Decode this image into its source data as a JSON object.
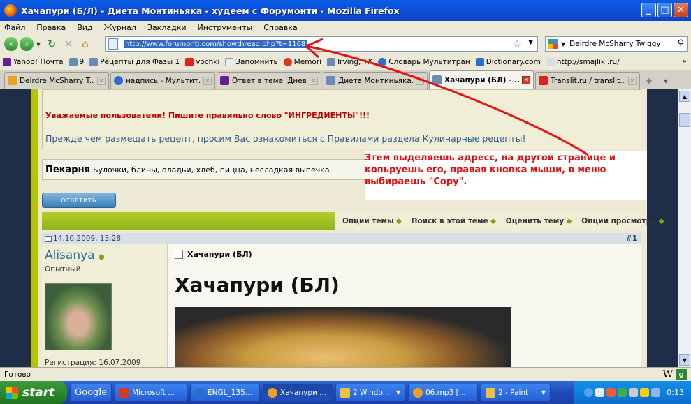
{
  "window": {
    "title": "Хачапури (Б/Л) - Диета Монтиньяка - худеем с Форумонти - Mozilla Firefox",
    "buttons": [
      "_",
      "□",
      "✕"
    ]
  },
  "menu": [
    "Файл",
    "Правка",
    "Вид",
    "Журнал",
    "Закладки",
    "Инструменты",
    "Справка"
  ],
  "nav": {
    "url": "http://www.forumonti.com/showthread.php?t=1168",
    "search_value": "Deirdre McSharry Twiggy"
  },
  "bookmarks": [
    {
      "label": "Yahoo! Почта",
      "color": "#6a1b9a"
    },
    {
      "label": "9",
      "color": "#6b8bb8"
    },
    {
      "label": "Рецепты для Фазы 1",
      "color": "#6b8bb8"
    },
    {
      "label": "vochki",
      "color": "#d9231c"
    },
    {
      "label": "Запомнить",
      "color": "#e6eefa"
    },
    {
      "label": "Memori",
      "color": "#d9391c"
    },
    {
      "label": "Irving, TX",
      "color": "#6b8bb8"
    },
    {
      "label": "Словарь Мультитран",
      "color": "#2a6fd0"
    },
    {
      "label": "Dictionary.com",
      "color": "#2a6fd0"
    },
    {
      "label": "http://smajliki.ru/",
      "color": "#777777"
    }
  ],
  "tabs": [
    {
      "label": "Deirdre McSharry T...",
      "color": "#f0a020",
      "active": false
    },
    {
      "label": "надпись - Мультит...",
      "color": "#2a6fd0",
      "active": false
    },
    {
      "label": "Ответ в теме 'Днев...",
      "color": "#6a1b9a",
      "active": false
    },
    {
      "label": "Диета Монтиньяка...",
      "color": "#6b8bb8",
      "active": false
    },
    {
      "label": "Хачапури (БЛ) - ...",
      "color": "#6b8bb8",
      "active": true
    },
    {
      "label": "Translit.ru / translit....",
      "color": "#d9231c",
      "active": false
    }
  ],
  "page": {
    "warning": "Уважаемые пользователи! Пишите правильно слово \"ИНГРЕДИЕНТЫ\"!!!",
    "rules_notice": "Прежде чем размещать рецепт, просим Вас ознакомиться с Правилами раздела Кулинарные рецепты!",
    "forum_name": "Пекарня",
    "forum_desc": "Булочки, блины, оладьи, хлеб, пицца, несладкая выпечка",
    "reply_button": "ОТВЕТИТЬ",
    "thread_options": [
      "Опции темы",
      "Поиск в этой теме",
      "Оценить тему",
      "Опции просмотра"
    ],
    "post_date": "14.10.2009, 13:28",
    "post_number": "#1",
    "username": "Alisanya",
    "user_rank": "Опытный",
    "registration": "Регистрация: 16.07.2009",
    "post_title_small": "Хачапури (БЛ)",
    "post_title_large": "Хачапури (БЛ)"
  },
  "annotation": "Зтем выделяешь адресс, на другой странице и копьруешь его, правая кнопка мыши, в меню выбираешь \"Copy\".",
  "status": "Готово",
  "taskbar": {
    "start": "start",
    "items": [
      {
        "label": "Google",
        "active": false,
        "color": "#ffffff"
      },
      {
        "label": "Microsoft ...",
        "active": false,
        "color": "#d9391c"
      },
      {
        "label": "ENGL_135...",
        "active": false,
        "color": "#2a6fd0"
      },
      {
        "label": "Хачапури ...",
        "active": true,
        "color": "#f0a020"
      },
      {
        "label": "2 Windo...",
        "active": false,
        "color": "#f0c040"
      },
      {
        "label": "06.mp3 [...",
        "active": false,
        "color": "#f0a020"
      },
      {
        "label": "2 - Paint",
        "active": false,
        "color": "#f0c040"
      }
    ],
    "clock": "0:13"
  }
}
